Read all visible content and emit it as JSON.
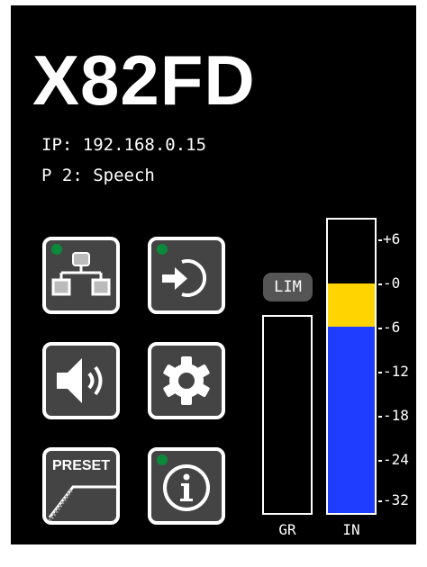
{
  "device": {
    "model": "X82FD",
    "ip_line": "IP: 192.168.0.15",
    "preset_line": "P 2: Speech"
  },
  "buttons": {
    "network": {
      "icon": "network-icon",
      "led": "on"
    },
    "input": {
      "icon": "input-loop-icon",
      "led": "on"
    },
    "volume": {
      "icon": "speaker-icon",
      "led": "off"
    },
    "settings": {
      "icon": "gear-icon",
      "led": "off"
    },
    "preset": {
      "label": "PRESET",
      "icon": "preset-curve-icon",
      "led": "off"
    },
    "info": {
      "icon": "info-icon",
      "led": "on"
    }
  },
  "limiter": {
    "label": "LIM",
    "active": false
  },
  "meters": {
    "gr": {
      "label": "GR"
    },
    "in": {
      "label": "IN"
    }
  },
  "scale": [
    "+6",
    "-0",
    "-6",
    "-12",
    "-18",
    "-24",
    "-32"
  ],
  "colors": {
    "background": "#000000",
    "button_fill": "#444444",
    "led_green": "#0a8a3a",
    "meter_blue": "#1f3dff",
    "meter_yellow": "#ffd400"
  }
}
